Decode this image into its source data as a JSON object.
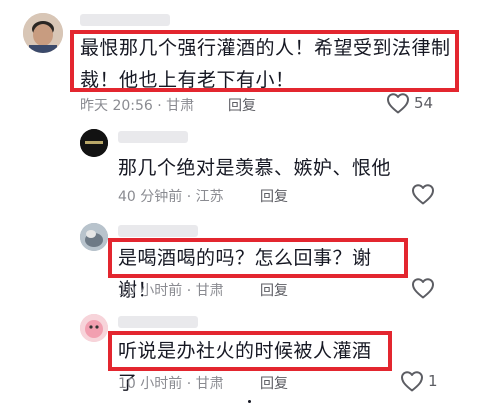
{
  "comments": [
    {
      "text": "最恨那几个强行灌酒的人！希望受到法律制裁！他也上有老下有小！",
      "meta": "昨天 20:56 · 甘肃",
      "reply_label": "回复",
      "likes": "54"
    },
    {
      "text": "那几个绝对是羡慕、嫉妒、恨他",
      "meta": "40 分钟前 · 江苏",
      "reply_label": "回复",
      "likes": ""
    },
    {
      "text": "是喝酒喝的吗？怎么回事？谢谢！",
      "meta": "10 小时前 · 甘肃",
      "reply_label": "回复",
      "likes": ""
    },
    {
      "text": "听说是办社火的时候被人灌酒了",
      "meta": "10 小时前 · 甘肃",
      "reply_label": "回复",
      "likes": "1"
    }
  ],
  "colors": {
    "highlight_border": "#e3262f",
    "meta_text": "#8a8b91",
    "body_text": "#161823"
  },
  "icons": {
    "like": "heart-outline-icon"
  }
}
